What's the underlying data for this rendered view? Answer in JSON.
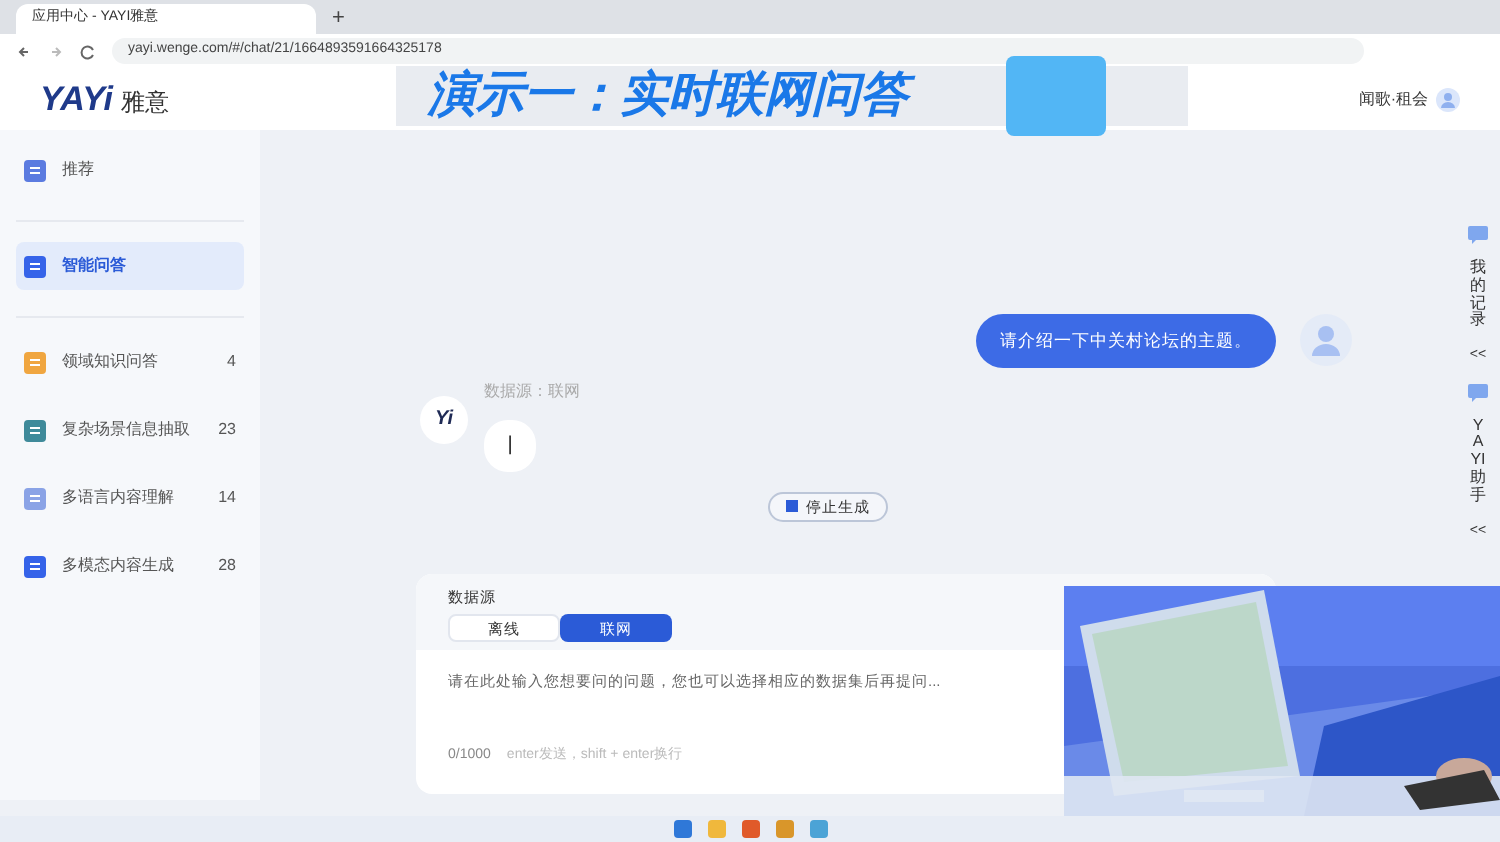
{
  "browser": {
    "tab_title": "应用中心 - YAYI雅意",
    "new_tab": "+",
    "url": "yayi.wenge.com/#/chat/21/1664893591664325178"
  },
  "banner": {
    "text": "演示一：实时联网问答"
  },
  "header": {
    "logo": "YAYi",
    "logo_cn": "雅意",
    "user": "闻歌·租会"
  },
  "sidebar": {
    "items": [
      {
        "label": "推荐",
        "selected": false,
        "color": "#5b7be0"
      },
      {
        "label": "智能问答",
        "selected": true,
        "color": "#3563e9"
      },
      {
        "label": "领域知识问答",
        "count": "4",
        "selected": false,
        "color": "#f0a640"
      },
      {
        "label": "复杂场景信息抽取",
        "count": "23",
        "selected": false,
        "color": "#3f8a9a"
      },
      {
        "label": "多语言内容理解",
        "count": "14",
        "selected": false,
        "color": "#8aa3e6"
      },
      {
        "label": "多模态内容生成",
        "count": "28",
        "selected": false,
        "color": "#3563e9"
      }
    ]
  },
  "chat": {
    "user_message": "请介绍一下中关村论坛的主题。",
    "source_label": "数据源：联网",
    "bot_logo": "Yi",
    "typing_cursor": "|",
    "stop_button": "停止生成"
  },
  "composer": {
    "source_title": "数据源",
    "sources": [
      {
        "label": "离线",
        "selected": false
      },
      {
        "label": "联网",
        "selected": true
      }
    ],
    "placeholder": "请在此处输入您想要问的问题，您也可以选择相应的数据集后再提问...",
    "counter": "0/1000",
    "hint": "enter发送，shift + enter换行"
  },
  "right_rail": [
    {
      "label": "我的记录",
      "toggle": "<<"
    },
    {
      "label": "YAYI助手",
      "toggle": "<<"
    }
  ]
}
